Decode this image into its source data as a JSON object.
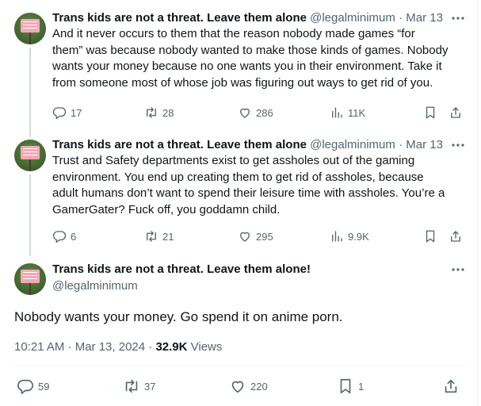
{
  "thread": [
    {
      "name": "Trans kids are not a threat. Leave them alone",
      "handle": "@legalminimum",
      "dot": "·",
      "date": "Mar 13",
      "lines": [
        "And it never occurs to them that the reason nobody made games “for",
        "them” was because nobody wanted to make those kinds of games. Nobody",
        "wants your money because no one wants you in their environment. Take it",
        "from someone most of whose job was figuring out ways to get rid of you."
      ],
      "replies": "17",
      "reposts": "28",
      "likes": "286",
      "views": "11K"
    },
    {
      "name": "Trans kids are not a threat. Leave them alone",
      "handle": "@legalminimum",
      "dot": "·",
      "date": "Mar 13",
      "lines": [
        "Trust and Safety departments exist to get assholes out of the gaming",
        "environment. You end up creating them to get rid of assholes, because",
        "adult humans don’t want to spend their leisure time with assholes. You’re a",
        "GamerGater? Fuck off, you goddamn child."
      ],
      "replies": "6",
      "reposts": "21",
      "likes": "295",
      "views": "9.9K"
    }
  ],
  "main": {
    "name": "Trans kids are not a threat. Leave them alone!",
    "handle": "@legalminimum",
    "text": "Nobody wants your money. Go spend it on anime porn.",
    "time": "10:21 AM · Mar 13, 2024 ·",
    "views_count": "32.9K",
    "views_label": "Views",
    "replies": "59",
    "reposts": "37",
    "likes": "220",
    "bookmarks": "1"
  },
  "icons": {
    "reply": "reply-icon",
    "repost": "repost-icon",
    "like": "like-icon",
    "views": "views-icon",
    "bookmark": "bookmark-icon",
    "share": "share-icon",
    "more": "more-icon"
  },
  "colors": {
    "text": "#0f1419",
    "secondary": "#536471",
    "thread_line": "#cfd9de",
    "divider": "#eff3f4"
  }
}
